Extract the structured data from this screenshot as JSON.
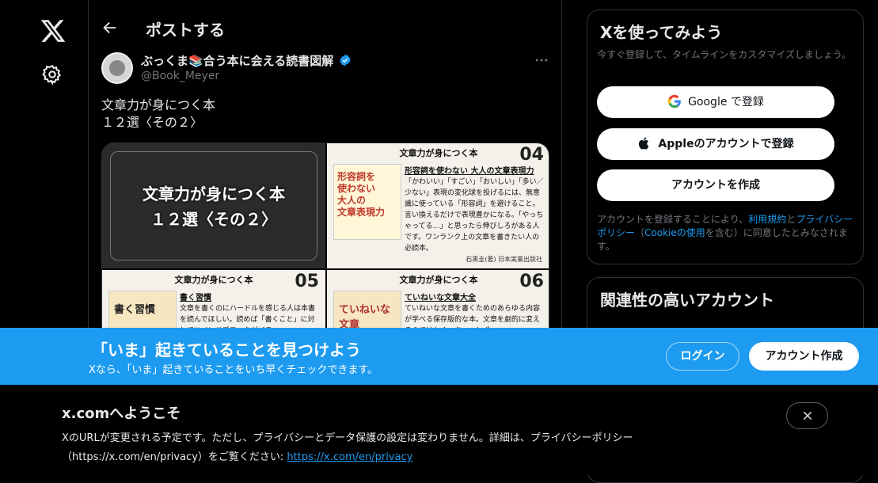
{
  "nav": {
    "logo_icon": "x-logo-icon",
    "settings_icon": "gear-icon"
  },
  "header": {
    "title": "ポストする"
  },
  "post": {
    "author": "ぶっくま📚合う本に会える読書図解",
    "handle": "@Book_Meyer",
    "text": "文章力が身につく本\n１２選〈その２〉",
    "media": {
      "cover_title": "文章力が身につく本\n１２選〈その２〉",
      "card_04": {
        "header": "文章力が身につく本",
        "number": "04",
        "book_label": "形容詞を\n使わない\n大人の\n文章表現力",
        "subtitle": "形容詞を使わない 大人の文章表現力",
        "body": "「かわいい」「すごい」「おいしい」「多い／少ない」表現の変化球を投げるには、無意識に使っている「形容詞」を避けること。言い換えるだけで表現豊かになる。「やっちゃってる…」と思ったら伸びしろがある人です。ワンランク上の文章を書きたい人の必読本。",
        "publisher": "石黒圭(著) 日本実業出版社"
      },
      "card_05": {
        "header": "文章力が身につく本",
        "number": "05",
        "book_label": "書く習慣",
        "subtitle": "書く習慣",
        "body": "文章を書くのにハードルを感じる人は本書を読んでほしい。読めば「書くこと」に対してマインドブロックがバラ"
      },
      "card_06": {
        "header": "文章力が身につく本",
        "number": "06",
        "book_label": "ていねいな\n文章",
        "subtitle": "ていねいな文章大全",
        "body": "ていねいな文章を書くためのあらゆる内容が学べる保存版的な本。文章を劇的に変えるのではなく、ちょっとずつ"
      }
    }
  },
  "signup": {
    "title": "Xを使ってみよう",
    "subtitle": "今すぐ登録して、タイムラインをカスタマイズしましょう。",
    "google_label": "Google で登録",
    "apple_label": "Appleのアカウントで登録",
    "create_label": "アカウントを作成",
    "legal_prefix": "アカウントを登録することにより、",
    "legal_terms": "利用規約",
    "legal_and": "と",
    "legal_privacy": "プライバシーポリシー",
    "legal_paren_open": "（",
    "legal_cookie": "Cookieの使用",
    "legal_suffix": "を含む）に同意したとみなされます。"
  },
  "related": {
    "title": "関連性の高いアカウント"
  },
  "banner": {
    "title": "「いま」起きていることを見つけよう",
    "subtitle": "Xなら、「いま」起きていることをいち早くチェックできます。",
    "login_label": "ログイン",
    "signup_label": "アカウント作成",
    "color": "#1d9bf0"
  },
  "welcome": {
    "title": "x.comへようこそ",
    "body": "XのURLが変更される予定です。ただし、プライバシーとデータ保護の設定は変わりません。詳細は、プライバシーポリシー（https://x.com/en/privacy）をご覧ください: ",
    "link": "https://x.com/en/privacy",
    "close_icon": "close-icon"
  }
}
